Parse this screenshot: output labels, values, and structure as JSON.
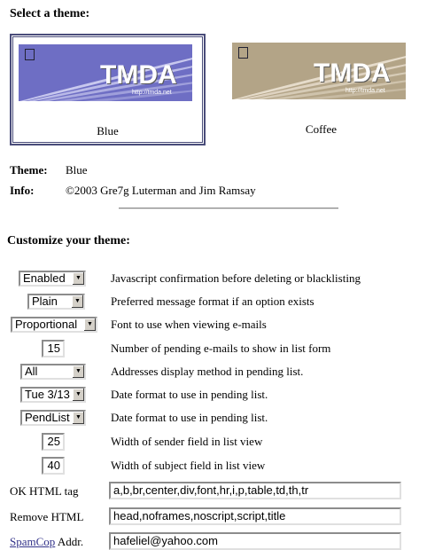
{
  "select_theme": {
    "heading": "Select a theme:",
    "themes": [
      {
        "name": "Blue",
        "logo": "TMDA",
        "url": "http://tmda.net",
        "bg": "#6e6ec4",
        "stripe": "#c8c8ee",
        "selected": true
      },
      {
        "name": "Coffee",
        "logo": "TMDA",
        "url": "http://tmda.net",
        "bg": "#b3a487",
        "stripe": "#e6dccb",
        "selected": false
      }
    ]
  },
  "theme_info": {
    "theme_label": "Theme:",
    "theme_value": "Blue",
    "info_label": "Info:",
    "info_value": "©2003 Gre7g Luterman and Jim Ramsay"
  },
  "customize": {
    "heading": "Customize your theme:",
    "rows": [
      {
        "control": "select",
        "value": "Enabled",
        "desc": "Javascript confirmation before deleting or blacklisting"
      },
      {
        "control": "select",
        "value": "Plain",
        "desc": "Preferred message format if an option exists"
      },
      {
        "control": "select",
        "value": "Proportional",
        "desc": "Font to use when viewing e-mails"
      },
      {
        "control": "text",
        "value": "15",
        "desc": "Number of pending e-mails to show in list form"
      },
      {
        "control": "select",
        "value": "All",
        "desc": "Addresses display method in pending list."
      },
      {
        "control": "select",
        "value": "Tue 3/13",
        "desc": "Date format to use in pending list."
      },
      {
        "control": "select",
        "value": "PendList",
        "desc": "Date format to use in pending list."
      },
      {
        "control": "text",
        "value": "25",
        "desc": "Width of sender field in list view"
      },
      {
        "control": "text",
        "value": "40",
        "desc": "Width of subject field in list view"
      }
    ],
    "ok_html": {
      "label": "OK HTML tag",
      "value": "a,b,br,center,div,font,hr,i,p,table,td,th,tr"
    },
    "remove_html": {
      "label": "Remove HTML",
      "value": "head,noframes,noscript,script,title"
    },
    "spamcop": {
      "link": "SpamCop",
      "label": "Addr.",
      "value": "hafeliel@yahoo.com"
    }
  }
}
